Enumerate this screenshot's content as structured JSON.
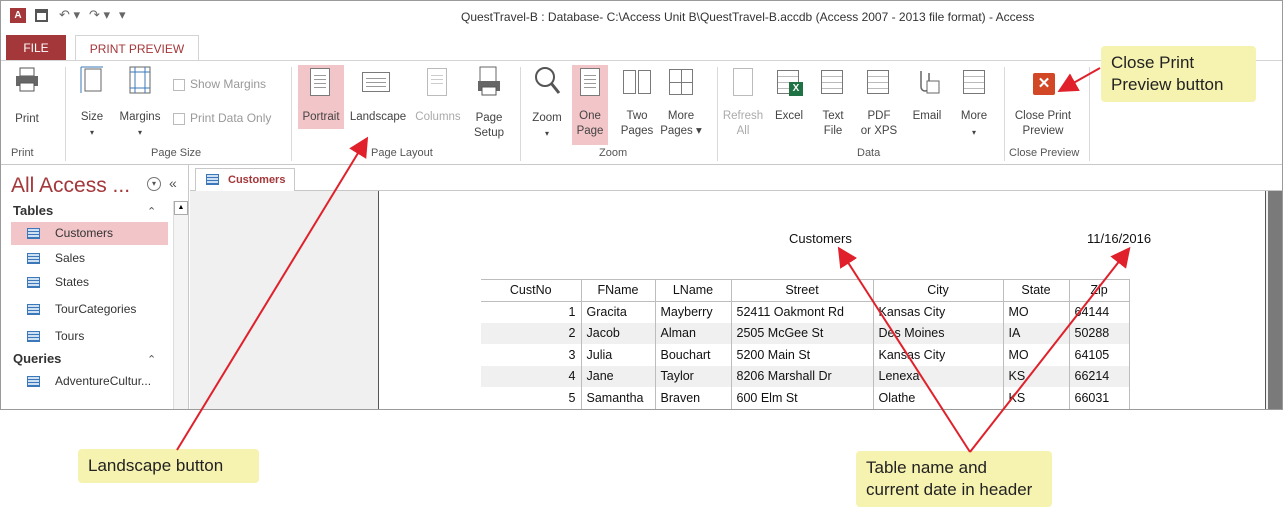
{
  "window": {
    "title": "QuestTravel-B : Database- C:\\Access Unit B\\QuestTravel-B.accdb (Access 2007 - 2013 file format) - Access"
  },
  "ribbon_tabs": {
    "file": "FILE",
    "print_preview": "PRINT PREVIEW"
  },
  "ribbon": {
    "print": "Print",
    "size": "Size",
    "margins": "Margins",
    "show_margins": "Show Margins",
    "print_data_only": "Print Data Only",
    "portrait": "Portrait",
    "landscape": "Landscape",
    "columns": "Columns",
    "page_setup_1": "Page",
    "page_setup_2": "Setup",
    "zoom": "Zoom",
    "one_page_1": "One",
    "one_page_2": "Page",
    "two_pages_1": "Two",
    "two_pages_2": "Pages",
    "more_pages_1": "More",
    "more_pages_2": "Pages ▾",
    "refresh_1": "Refresh",
    "refresh_2": "All",
    "excel": "Excel",
    "text_file_1": "Text",
    "text_file_2": "File",
    "pdf_1": "PDF",
    "pdf_2": "or XPS",
    "email": "Email",
    "more": "More",
    "close_1": "Close Print",
    "close_2": "Preview",
    "groups": {
      "print": "Print",
      "page_size": "Page Size",
      "page_layout": "Page Layout",
      "zoom": "Zoom",
      "data": "Data",
      "close_preview": "Close Preview"
    }
  },
  "nav": {
    "title": "All Access ...",
    "tables_header": "Tables",
    "tables": [
      "Customers",
      "Sales",
      "States",
      "TourCategories",
      "Tours"
    ],
    "queries_header": "Queries",
    "queries": [
      "AdventureCultur..."
    ]
  },
  "doc_tab": "Customers",
  "report": {
    "header_title": "Customers",
    "header_date": "11/16/2016"
  },
  "table": {
    "columns": [
      "CustNo",
      "FName",
      "LName",
      "Street",
      "City",
      "State",
      "Zip"
    ],
    "rows": [
      [
        "1",
        "Gracita",
        "Mayberry",
        "52411 Oakmont Rd",
        "Kansas City",
        "MO",
        "64144"
      ],
      [
        "2",
        "Jacob",
        "Alman",
        "2505 McGee St",
        "Des Moines",
        "IA",
        "50288"
      ],
      [
        "3",
        "Julia",
        "Bouchart",
        "5200 Main St",
        "Kansas City",
        "MO",
        "64105"
      ],
      [
        "4",
        "Jane",
        "Taylor",
        "8206 Marshall Dr",
        "Lenexa",
        "KS",
        "66214"
      ],
      [
        "5",
        "Samantha",
        "Braven",
        "600 Elm St",
        "Olathe",
        "KS",
        "66031"
      ]
    ]
  },
  "callouts": {
    "close_print_preview": [
      "Close Print",
      "Preview button"
    ],
    "landscape": "Landscape button",
    "table_name_date": [
      "Table name and",
      "current date in header"
    ]
  },
  "colors": {
    "access_red": "#a4373a",
    "highlight": "#f2c5c8",
    "callout_bg": "#f6f2b0",
    "arrow": "#e0212b"
  }
}
